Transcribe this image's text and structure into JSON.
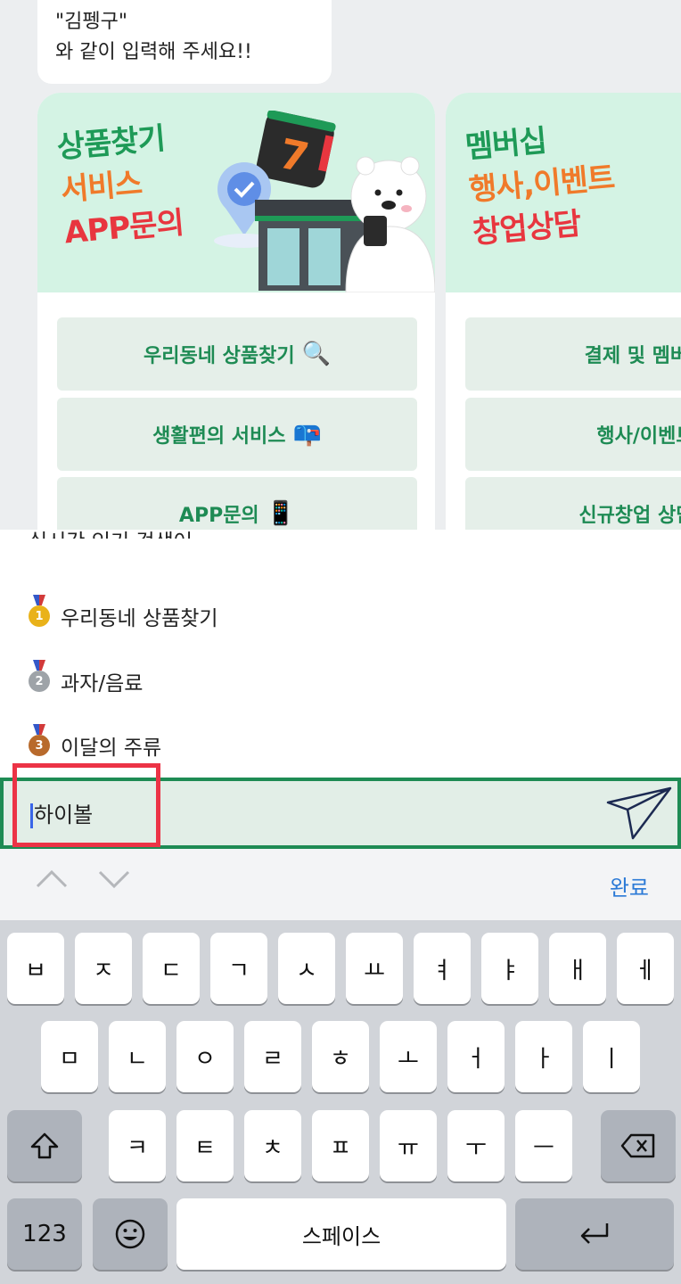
{
  "chat": {
    "bubble_line1": "\"김펭구\"",
    "bubble_line2": "와 같이 입력해 주세요!!",
    "card1": {
      "banner_lines": [
        "상품찾기",
        "서비스",
        "APP문의"
      ],
      "buttons": [
        {
          "label": "우리동네 상품찾기",
          "emoji": "🔍"
        },
        {
          "label": "생활편의 서비스",
          "emoji": "📪"
        },
        {
          "label": "APP문의",
          "emoji": "📱"
        }
      ]
    },
    "card2": {
      "banner_lines": [
        "멤버십",
        "행사,이벤트",
        "창업상담"
      ],
      "buttons": [
        {
          "label": "결제 및 멤버십"
        },
        {
          "label": "행사/이벤트"
        },
        {
          "label": "신규창업 상담신"
        }
      ]
    }
  },
  "suggestions": {
    "partial_header": "실시간 인기 검색어",
    "items": [
      {
        "rank": "1",
        "label": "우리동네 상품찾기",
        "medal_color": "#e9b21a"
      },
      {
        "rank": "2",
        "label": "과자/음료",
        "medal_color": "#9ea3a8"
      },
      {
        "rank": "3",
        "label": "이달의 주류",
        "medal_color": "#b86a2c"
      }
    ]
  },
  "input": {
    "value": "하이볼",
    "border_color": "#1e8b54",
    "highlight_color": "#ec3346"
  },
  "toolbar": {
    "up_icon": "chevron-up-icon",
    "down_icon": "chevron-down-icon",
    "done_label": "완료"
  },
  "keyboard": {
    "row1": [
      "ㅂ",
      "ㅈ",
      "ㄷ",
      "ㄱ",
      "ㅅ",
      "ㅛ",
      "ㅕ",
      "ㅑ",
      "ㅐ",
      "ㅔ"
    ],
    "row2": [
      "ㅁ",
      "ㄴ",
      "ㅇ",
      "ㄹ",
      "ㅎ",
      "ㅗ",
      "ㅓ",
      "ㅏ",
      "ㅣ"
    ],
    "row3": [
      "ㅋ",
      "ㅌ",
      "ㅊ",
      "ㅍ",
      "ㅠ",
      "ㅜ",
      "ㅡ"
    ],
    "numbers_label": "123",
    "space_label": "스페이스"
  }
}
